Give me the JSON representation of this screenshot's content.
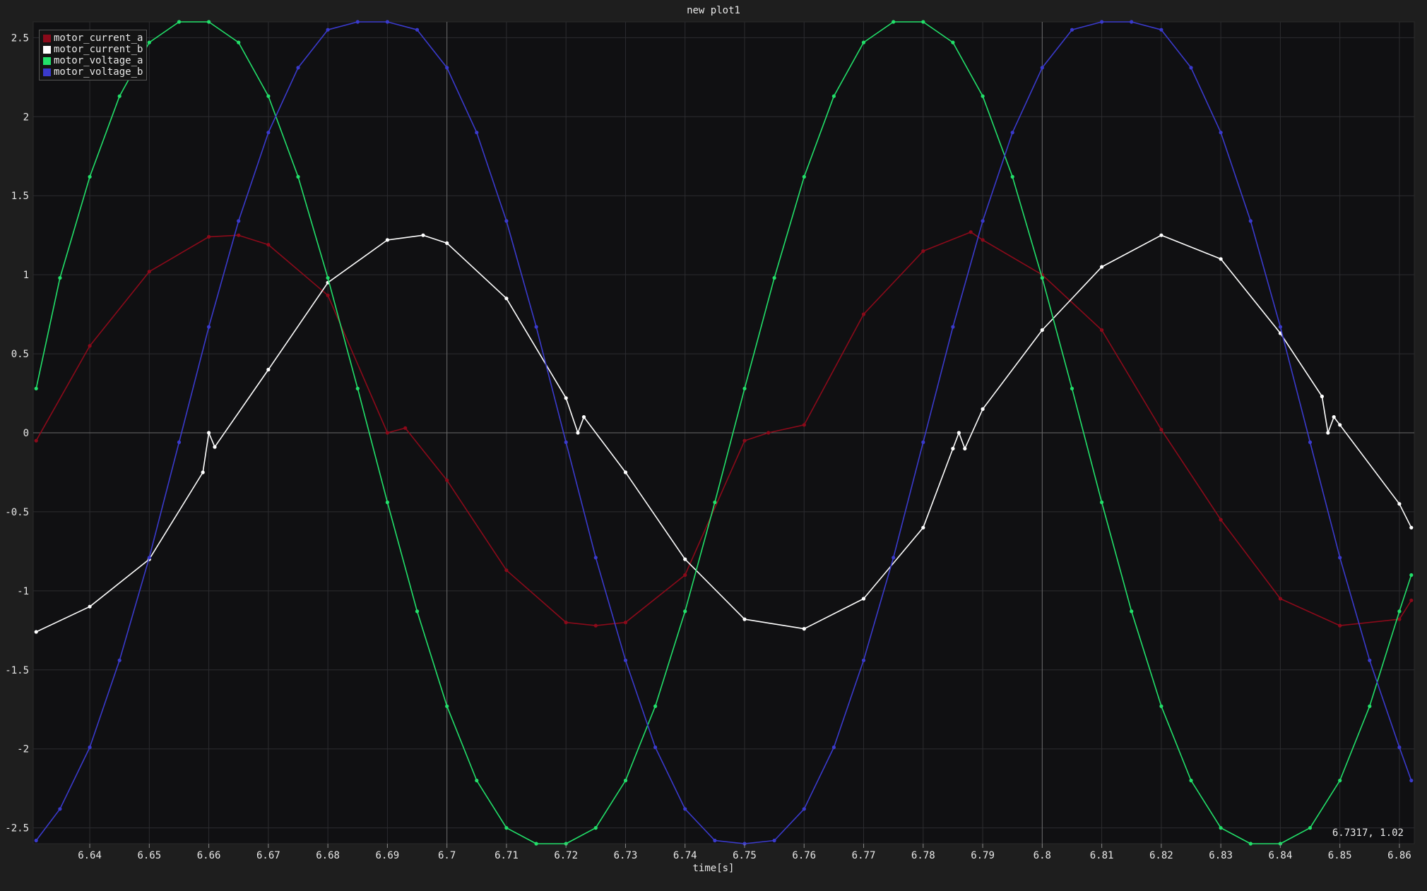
{
  "window": {
    "title": "new plot1",
    "coordinate_readout": "6.7317, 1.02"
  },
  "colors": {
    "background": "#1e1e1e",
    "plot_area": "#101012",
    "grid": "#2c2c30",
    "zero_line": "#6a6a6a",
    "cursor_line": "#6a6a6a"
  },
  "chart_data": {
    "type": "line",
    "title": "new plot1",
    "xlabel": "time[s]",
    "ylabel": "",
    "xlim": [
      6.6305,
      6.8625
    ],
    "ylim": [
      -2.6,
      2.6
    ],
    "x_ticks": [
      6.64,
      6.65,
      6.66,
      6.67,
      6.68,
      6.69,
      6.7,
      6.71,
      6.72,
      6.73,
      6.74,
      6.75,
      6.76,
      6.77,
      6.78,
      6.79,
      6.8,
      6.81,
      6.82,
      6.83,
      6.84,
      6.85,
      6.86
    ],
    "x_tick_labels": [
      "6.64",
      "6.65",
      "6.66",
      "6.67",
      "6.68",
      "6.69",
      "6.7",
      "6.71",
      "6.72",
      "6.73",
      "6.74",
      "6.75",
      "6.76",
      "6.77",
      "6.78",
      "6.79",
      "6.8",
      "6.81",
      "6.82",
      "6.83",
      "6.84",
      "6.85",
      "6.86"
    ],
    "y_ticks": [
      2.5,
      2,
      1.5,
      1,
      0.5,
      0,
      -0.5,
      -1,
      -1.5,
      -2,
      -2.5
    ],
    "y_tick_labels": [
      "2.5",
      "2",
      "1.5",
      "1",
      "0.5",
      "0",
      "-0.5",
      "-1",
      "-1.5",
      "-2",
      "-2.5"
    ],
    "major_x_lines": [
      6.7,
      6.8
    ],
    "grid": true,
    "markers": true,
    "legend_position": "top-left",
    "series": [
      {
        "name": "motor_current_a",
        "color": "#8b0a1a",
        "x": [
          6.631,
          6.64,
          6.65,
          6.66,
          6.665,
          6.67,
          6.68,
          6.69,
          6.693,
          6.7,
          6.71,
          6.72,
          6.725,
          6.73,
          6.74,
          6.75,
          6.754,
          6.76,
          6.77,
          6.78,
          6.788,
          6.79,
          6.8,
          6.81,
          6.82,
          6.83,
          6.84,
          6.85,
          6.86,
          6.862
        ],
        "y": [
          -0.05,
          0.55,
          1.02,
          1.24,
          1.25,
          1.19,
          0.87,
          0.0,
          0.03,
          -0.3,
          -0.87,
          -1.2,
          -1.22,
          -1.2,
          -0.9,
          -0.05,
          0.0,
          0.05,
          0.75,
          1.15,
          1.27,
          1.22,
          1.0,
          0.65,
          0.02,
          -0.55,
          -1.05,
          -1.22,
          -1.18,
          -1.06
        ]
      },
      {
        "name": "motor_current_b",
        "color": "#ffffff",
        "x": [
          6.631,
          6.64,
          6.65,
          6.659,
          6.66,
          6.661,
          6.67,
          6.68,
          6.69,
          6.696,
          6.7,
          6.71,
          6.72,
          6.722,
          6.723,
          6.73,
          6.74,
          6.75,
          6.76,
          6.77,
          6.78,
          6.785,
          6.786,
          6.787,
          6.79,
          6.8,
          6.81,
          6.82,
          6.83,
          6.84,
          6.847,
          6.848,
          6.849,
          6.85,
          6.86,
          6.862
        ],
        "y": [
          -1.26,
          -1.1,
          -0.8,
          -0.25,
          0.0,
          -0.09,
          0.4,
          0.95,
          1.22,
          1.25,
          1.2,
          0.85,
          0.22,
          0.0,
          0.1,
          -0.25,
          -0.8,
          -1.18,
          -1.24,
          -1.05,
          -0.6,
          -0.1,
          0.0,
          -0.1,
          0.15,
          0.65,
          1.05,
          1.25,
          1.1,
          0.63,
          0.23,
          0.0,
          0.1,
          0.05,
          -0.45,
          -0.6
        ]
      },
      {
        "name": "motor_voltage_a",
        "color": "#22e06a",
        "x": [
          6.631,
          6.635,
          6.64,
          6.645,
          6.65,
          6.655,
          6.66,
          6.665,
          6.67,
          6.675,
          6.68,
          6.685,
          6.69,
          6.695,
          6.7,
          6.705,
          6.71,
          6.715,
          6.72,
          6.725,
          6.73,
          6.735,
          6.74,
          6.745,
          6.75,
          6.755,
          6.76,
          6.765,
          6.77,
          6.775,
          6.78,
          6.785,
          6.79,
          6.795,
          6.8,
          6.805,
          6.81,
          6.815,
          6.82,
          6.825,
          6.83,
          6.835,
          6.84,
          6.845,
          6.85,
          6.855,
          6.86,
          6.862
        ],
        "y": [
          0.28,
          0.98,
          1.62,
          2.13,
          2.47,
          2.6,
          2.6,
          2.47,
          2.13,
          1.62,
          0.98,
          0.28,
          -0.44,
          -1.13,
          -1.73,
          -2.2,
          -2.5,
          -2.6,
          -2.6,
          -2.5,
          -2.2,
          -1.73,
          -1.13,
          -0.44,
          0.28,
          0.98,
          1.62,
          2.13,
          2.47,
          2.6,
          2.6,
          2.47,
          2.13,
          1.62,
          0.98,
          0.28,
          -0.44,
          -1.13,
          -1.73,
          -2.2,
          -2.5,
          -2.6,
          -2.6,
          -2.5,
          -2.2,
          -1.73,
          -1.13,
          -0.9
        ]
      },
      {
        "name": "motor_voltage_b",
        "color": "#3a3acc",
        "x": [
          6.631,
          6.635,
          6.64,
          6.645,
          6.65,
          6.655,
          6.66,
          6.665,
          6.67,
          6.675,
          6.68,
          6.685,
          6.69,
          6.695,
          6.7,
          6.705,
          6.71,
          6.715,
          6.72,
          6.725,
          6.73,
          6.735,
          6.74,
          6.745,
          6.75,
          6.755,
          6.76,
          6.765,
          6.77,
          6.775,
          6.78,
          6.785,
          6.79,
          6.795,
          6.8,
          6.805,
          6.81,
          6.815,
          6.82,
          6.825,
          6.83,
          6.835,
          6.84,
          6.845,
          6.85,
          6.855,
          6.86,
          6.862
        ],
        "y": [
          -2.58,
          -2.38,
          -1.99,
          -1.44,
          -0.79,
          -0.06,
          0.67,
          1.34,
          1.9,
          2.31,
          2.55,
          2.6,
          2.6,
          2.55,
          2.31,
          1.9,
          1.34,
          0.67,
          -0.06,
          -0.79,
          -1.44,
          -1.99,
          -2.38,
          -2.58,
          -2.6,
          -2.58,
          -2.38,
          -1.99,
          -1.44,
          -0.79,
          -0.06,
          0.67,
          1.34,
          1.9,
          2.31,
          2.55,
          2.6,
          2.6,
          2.55,
          2.31,
          1.9,
          1.34,
          0.67,
          -0.06,
          -0.79,
          -1.44,
          -1.99,
          -2.2
        ]
      }
    ]
  }
}
